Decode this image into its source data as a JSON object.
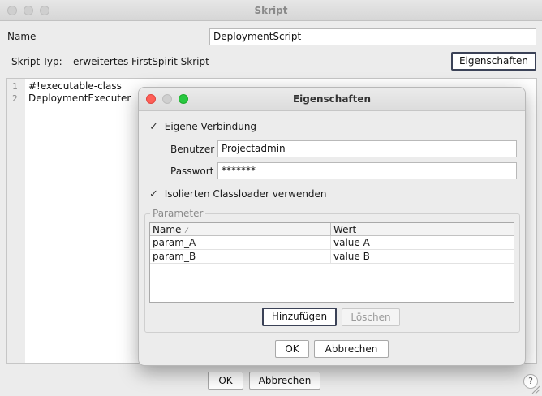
{
  "window": {
    "title": "Skript"
  },
  "form": {
    "name_label": "Name",
    "name_value": "DeploymentScript",
    "type_label": "Skript-Typ:",
    "type_value": "erweitertes FirstSpirit Skript",
    "properties_button": "Eigenschaften"
  },
  "editor": {
    "lines": [
      {
        "number": "1",
        "text": "#!executable-class"
      },
      {
        "number": "2",
        "text": "DeploymentExecuter"
      }
    ]
  },
  "dialog": {
    "title": "Eigenschaften",
    "own_connection_label": "Eigene Verbindung",
    "own_connection_checked": true,
    "user_label": "Benutzer",
    "user_value": "Projectadmin",
    "password_label": "Passwort",
    "password_value": "*******",
    "isolated_classloader_label": "Isolierten Classloader verwenden",
    "isolated_classloader_checked": true,
    "parameter_legend": "Parameter",
    "table": {
      "columns": [
        "Name",
        "Wert"
      ],
      "sort_indicator": "⁄",
      "rows": [
        {
          "name": "param_A",
          "value": "value A"
        },
        {
          "name": "param_B",
          "value": "value B"
        }
      ]
    },
    "add_button": "Hinzufügen",
    "delete_button": "Löschen",
    "ok_button": "OK",
    "cancel_button": "Abbrechen"
  },
  "footer": {
    "ok_button": "OK",
    "cancel_button": "Abbrechen",
    "help_glyph": "?"
  },
  "icons": {
    "check": "✓"
  }
}
